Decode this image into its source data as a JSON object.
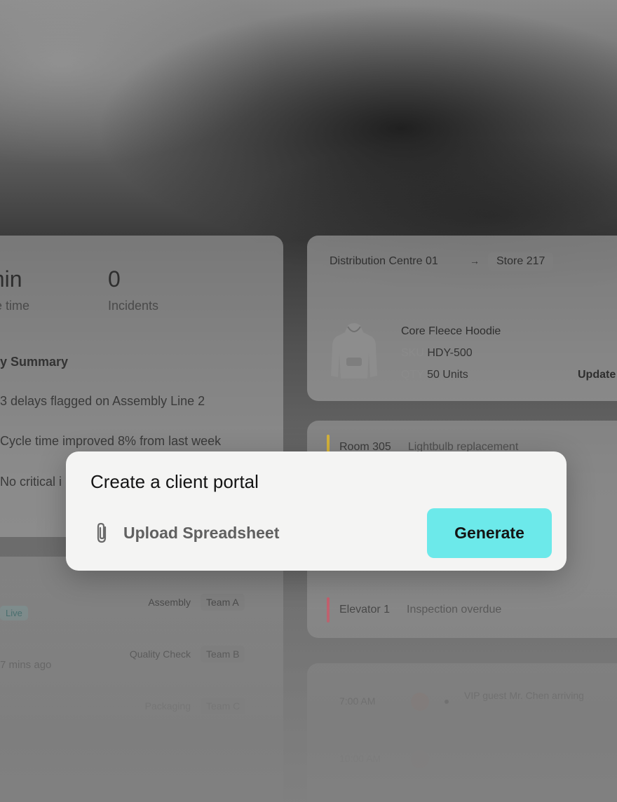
{
  "summary_card": {
    "stat1_value": "min",
    "stat1_label": "cle time",
    "stat2_value": "0",
    "stat2_label": "Incidents",
    "summary_title": "y Summary",
    "lines": [
      "3 delays flagged on Assembly Line 2",
      "Cycle time improved 8% from last week",
      "No critical i"
    ]
  },
  "teams_card": {
    "live_label": "Live",
    "time_ago": "7 mins ago",
    "rows": [
      {
        "step": "Assembly",
        "team": "Team A"
      },
      {
        "step": "Quality Check",
        "team": "Team B"
      },
      {
        "step": "Packaging",
        "team": "Team C"
      }
    ]
  },
  "shipment_card": {
    "origin": "Distribution Centre 01",
    "arrow": "→",
    "destination": "Store 217",
    "product_name": "Core Fleece Hoodie",
    "sku_label": "SKU",
    "sku_value": "HDY-500",
    "qty_label": "QTY",
    "qty_value": "50 Units",
    "update_label": "Update"
  },
  "tasks_card": {
    "tasks": [
      {
        "location": "Room 305",
        "description": "Lightbulb replacement",
        "color": "#d4b23a"
      },
      {
        "location": "Elevator 1",
        "description": "Inspection overdue",
        "color": "#d05a6a"
      }
    ]
  },
  "schedule_card": {
    "items": [
      {
        "time": "7:00 AM",
        "text": "VIP guest Mr. Chen arriving"
      },
      {
        "time": "10:00 AM",
        "text": ""
      }
    ]
  },
  "prompt": {
    "text": "Create a client portal",
    "upload_label": "Upload Spreadsheet",
    "generate_label": "Generate",
    "accent_color": "#6ce9ea"
  }
}
